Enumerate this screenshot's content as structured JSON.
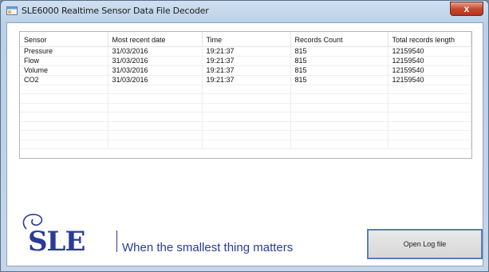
{
  "window": {
    "title": "SLE6000 Realtime Sensor Data File Decoder",
    "close_label": "x"
  },
  "table": {
    "columns": [
      "Sensor",
      "Most recent date",
      "Time",
      "Records Count",
      "Total records length"
    ],
    "rows": [
      [
        "Pressure",
        "31/03/2016",
        "19:21:37",
        "815",
        "12159540"
      ],
      [
        "Flow",
        "31/03/2016",
        "19:21:37",
        "815",
        "12159540"
      ],
      [
        "Volume",
        "31/03/2016",
        "19:21:37",
        "815",
        "12159540"
      ],
      [
        "CO2",
        "31/03/2016",
        "19:21:37",
        "815",
        "12159540"
      ]
    ]
  },
  "branding": {
    "logo_text": "SLE",
    "tagline": "When the smallest thing matters",
    "brand_color": "#2a3b97"
  },
  "actions": {
    "open_log_label": "Open Log file"
  }
}
